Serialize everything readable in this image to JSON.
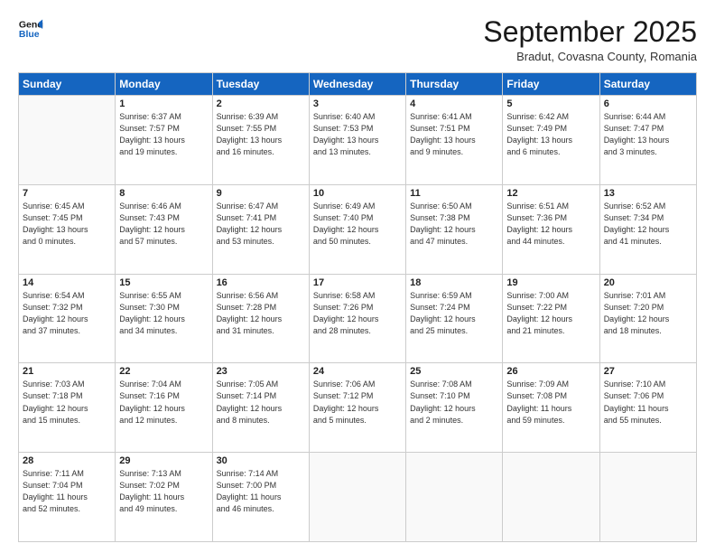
{
  "header": {
    "logo_line1": "General",
    "logo_line2": "Blue",
    "month": "September 2025",
    "location": "Bradut, Covasna County, Romania"
  },
  "weekdays": [
    "Sunday",
    "Monday",
    "Tuesday",
    "Wednesday",
    "Thursday",
    "Friday",
    "Saturday"
  ],
  "weeks": [
    [
      {
        "day": "",
        "info": ""
      },
      {
        "day": "1",
        "info": "Sunrise: 6:37 AM\nSunset: 7:57 PM\nDaylight: 13 hours\nand 19 minutes."
      },
      {
        "day": "2",
        "info": "Sunrise: 6:39 AM\nSunset: 7:55 PM\nDaylight: 13 hours\nand 16 minutes."
      },
      {
        "day": "3",
        "info": "Sunrise: 6:40 AM\nSunset: 7:53 PM\nDaylight: 13 hours\nand 13 minutes."
      },
      {
        "day": "4",
        "info": "Sunrise: 6:41 AM\nSunset: 7:51 PM\nDaylight: 13 hours\nand 9 minutes."
      },
      {
        "day": "5",
        "info": "Sunrise: 6:42 AM\nSunset: 7:49 PM\nDaylight: 13 hours\nand 6 minutes."
      },
      {
        "day": "6",
        "info": "Sunrise: 6:44 AM\nSunset: 7:47 PM\nDaylight: 13 hours\nand 3 minutes."
      }
    ],
    [
      {
        "day": "7",
        "info": "Sunrise: 6:45 AM\nSunset: 7:45 PM\nDaylight: 13 hours\nand 0 minutes."
      },
      {
        "day": "8",
        "info": "Sunrise: 6:46 AM\nSunset: 7:43 PM\nDaylight: 12 hours\nand 57 minutes."
      },
      {
        "day": "9",
        "info": "Sunrise: 6:47 AM\nSunset: 7:41 PM\nDaylight: 12 hours\nand 53 minutes."
      },
      {
        "day": "10",
        "info": "Sunrise: 6:49 AM\nSunset: 7:40 PM\nDaylight: 12 hours\nand 50 minutes."
      },
      {
        "day": "11",
        "info": "Sunrise: 6:50 AM\nSunset: 7:38 PM\nDaylight: 12 hours\nand 47 minutes."
      },
      {
        "day": "12",
        "info": "Sunrise: 6:51 AM\nSunset: 7:36 PM\nDaylight: 12 hours\nand 44 minutes."
      },
      {
        "day": "13",
        "info": "Sunrise: 6:52 AM\nSunset: 7:34 PM\nDaylight: 12 hours\nand 41 minutes."
      }
    ],
    [
      {
        "day": "14",
        "info": "Sunrise: 6:54 AM\nSunset: 7:32 PM\nDaylight: 12 hours\nand 37 minutes."
      },
      {
        "day": "15",
        "info": "Sunrise: 6:55 AM\nSunset: 7:30 PM\nDaylight: 12 hours\nand 34 minutes."
      },
      {
        "day": "16",
        "info": "Sunrise: 6:56 AM\nSunset: 7:28 PM\nDaylight: 12 hours\nand 31 minutes."
      },
      {
        "day": "17",
        "info": "Sunrise: 6:58 AM\nSunset: 7:26 PM\nDaylight: 12 hours\nand 28 minutes."
      },
      {
        "day": "18",
        "info": "Sunrise: 6:59 AM\nSunset: 7:24 PM\nDaylight: 12 hours\nand 25 minutes."
      },
      {
        "day": "19",
        "info": "Sunrise: 7:00 AM\nSunset: 7:22 PM\nDaylight: 12 hours\nand 21 minutes."
      },
      {
        "day": "20",
        "info": "Sunrise: 7:01 AM\nSunset: 7:20 PM\nDaylight: 12 hours\nand 18 minutes."
      }
    ],
    [
      {
        "day": "21",
        "info": "Sunrise: 7:03 AM\nSunset: 7:18 PM\nDaylight: 12 hours\nand 15 minutes."
      },
      {
        "day": "22",
        "info": "Sunrise: 7:04 AM\nSunset: 7:16 PM\nDaylight: 12 hours\nand 12 minutes."
      },
      {
        "day": "23",
        "info": "Sunrise: 7:05 AM\nSunset: 7:14 PM\nDaylight: 12 hours\nand 8 minutes."
      },
      {
        "day": "24",
        "info": "Sunrise: 7:06 AM\nSunset: 7:12 PM\nDaylight: 12 hours\nand 5 minutes."
      },
      {
        "day": "25",
        "info": "Sunrise: 7:08 AM\nSunset: 7:10 PM\nDaylight: 12 hours\nand 2 minutes."
      },
      {
        "day": "26",
        "info": "Sunrise: 7:09 AM\nSunset: 7:08 PM\nDaylight: 11 hours\nand 59 minutes."
      },
      {
        "day": "27",
        "info": "Sunrise: 7:10 AM\nSunset: 7:06 PM\nDaylight: 11 hours\nand 55 minutes."
      }
    ],
    [
      {
        "day": "28",
        "info": "Sunrise: 7:11 AM\nSunset: 7:04 PM\nDaylight: 11 hours\nand 52 minutes."
      },
      {
        "day": "29",
        "info": "Sunrise: 7:13 AM\nSunset: 7:02 PM\nDaylight: 11 hours\nand 49 minutes."
      },
      {
        "day": "30",
        "info": "Sunrise: 7:14 AM\nSunset: 7:00 PM\nDaylight: 11 hours\nand 46 minutes."
      },
      {
        "day": "",
        "info": ""
      },
      {
        "day": "",
        "info": ""
      },
      {
        "day": "",
        "info": ""
      },
      {
        "day": "",
        "info": ""
      }
    ]
  ]
}
